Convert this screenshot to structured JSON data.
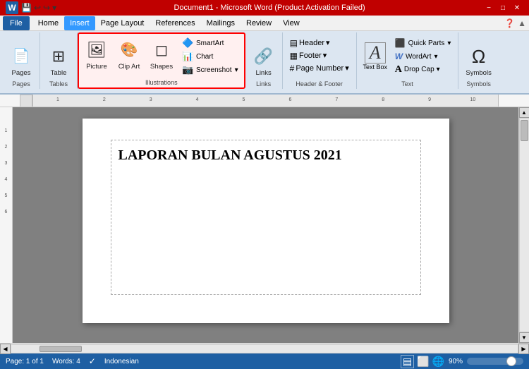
{
  "titlebar": {
    "title": "Document1 - Microsoft Word (Product Activation Failed)",
    "minimize": "−",
    "maximize": "□",
    "close": "✕"
  },
  "menubar": {
    "file": "File",
    "tabs": [
      "Home",
      "Insert",
      "Page Layout",
      "References",
      "Mailings",
      "Review",
      "View"
    ]
  },
  "ribbon": {
    "active_tab": "Insert",
    "groups": {
      "pages": {
        "label": "Pages",
        "btn": "Pages"
      },
      "tables": {
        "label": "Tables",
        "btn": "Table"
      },
      "illustrations": {
        "label": "Illustrations",
        "picture_btn": "Picture",
        "clipart_btn": "Clip Art",
        "shapes_btn": "Shapes",
        "smartart_btn": "SmartArt",
        "chart_btn": "Chart",
        "screenshot_btn": "Screenshot"
      },
      "links": {
        "label": "Links",
        "btn": "Links"
      },
      "header_footer": {
        "label": "Header & Footer",
        "header_btn": "Header",
        "footer_btn": "Footer",
        "pagenumber_btn": "Page Number"
      },
      "text": {
        "label": "Text",
        "textbox_btn": "Text Box",
        "wordart_btn": "WordArt",
        "dropcap_btn": "Drop Cap",
        "quickparts_btn": "Quick Parts"
      },
      "symbols": {
        "label": "Symbols",
        "symbols_btn": "Symbols",
        "omega_symbol": "Ω"
      }
    }
  },
  "document": {
    "title": "LAPORAN BULAN AGUSTUS 2021"
  },
  "statusbar": {
    "page": "Page: 1 of 1",
    "words": "Words: 4",
    "language": "Indonesian",
    "zoom": "90%"
  },
  "icons": {
    "pages": "📄",
    "table": "⊞",
    "picture": "🖼",
    "clipart": "✂",
    "shapes": "◻",
    "smartart": "🔷",
    "chart": "📊",
    "screenshot": "📷",
    "links": "🔗",
    "header": "▤",
    "footer": "▦",
    "pagenumber": "#",
    "textbox": "A",
    "wordart": "W",
    "dropcap": "A",
    "quickparts": "⬛",
    "symbols": "Ω",
    "scroll_up": "▲",
    "scroll_down": "▼",
    "scroll_left": "◀",
    "scroll_right": "▶"
  }
}
